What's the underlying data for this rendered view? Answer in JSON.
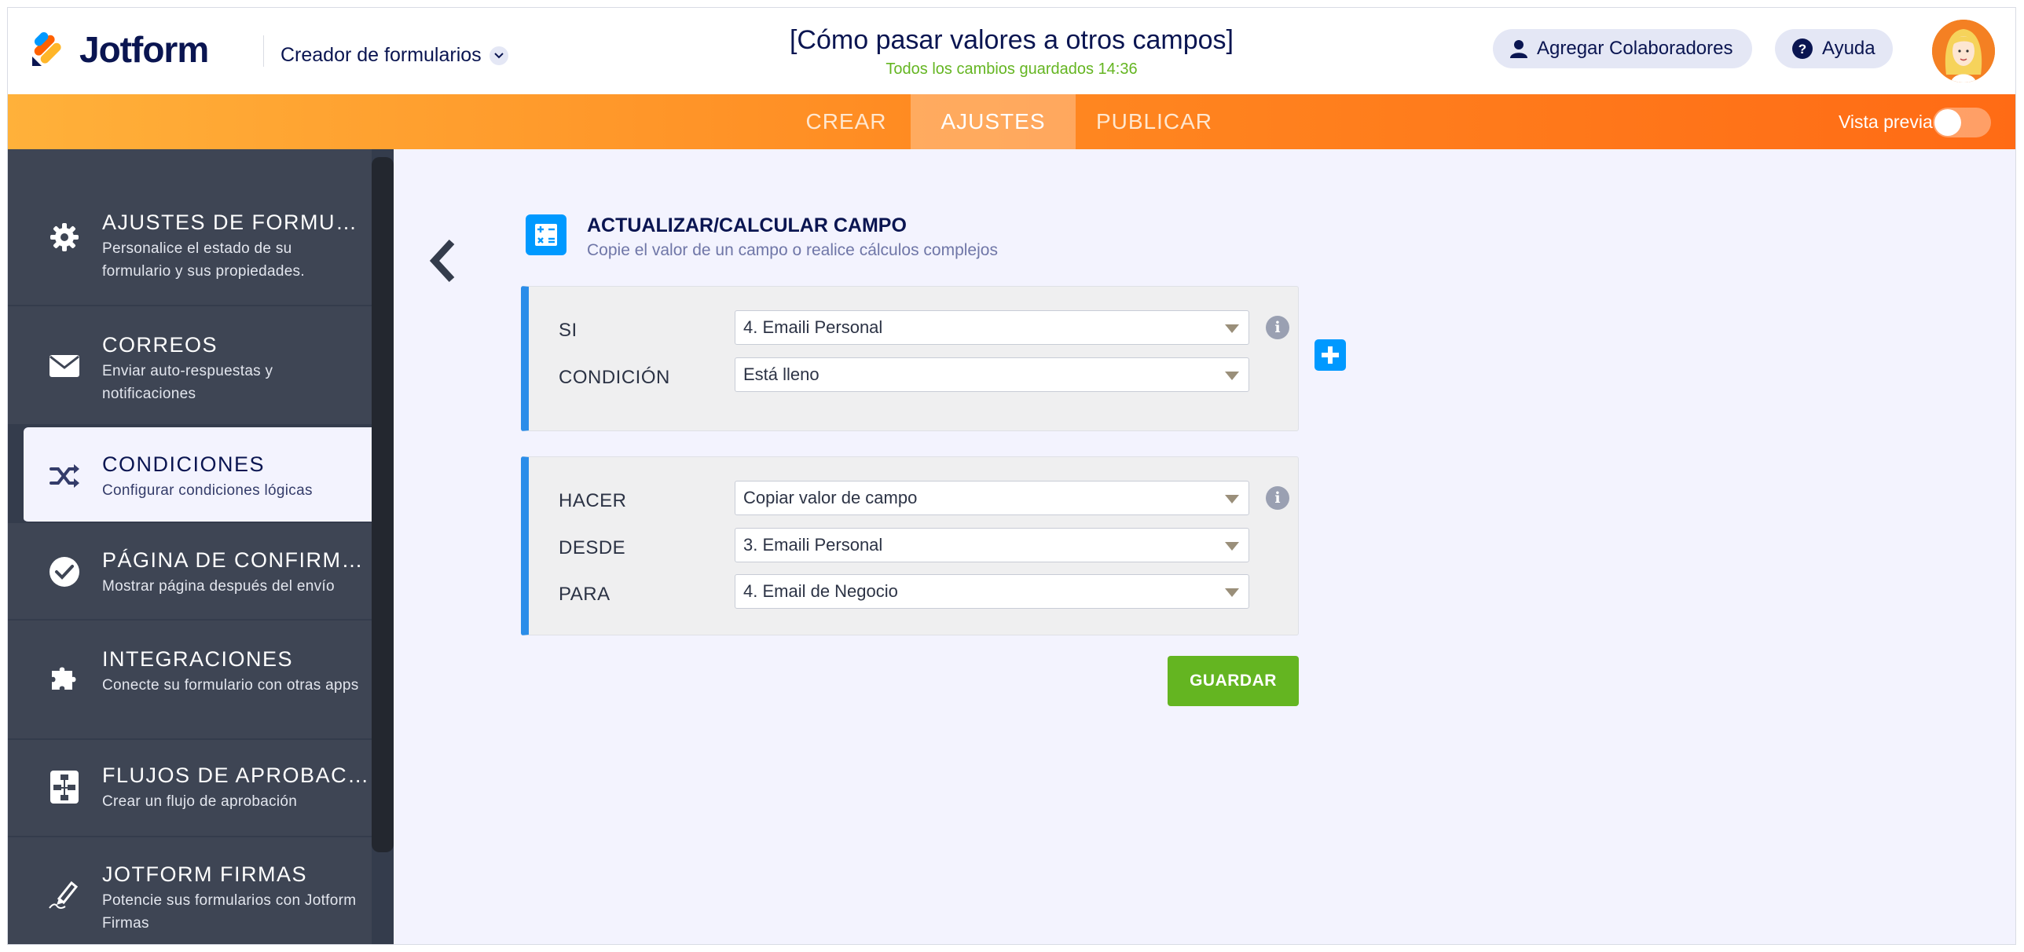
{
  "app": {
    "logo_text": "Jotform",
    "creator_label": "Creador de formularios"
  },
  "form": {
    "title": "[Cómo pasar valores a otros campos]",
    "saved_status": "Todos los cambios guardados 14:36"
  },
  "header": {
    "collaborators_label": "Agregar Colaboradores",
    "help_label": "Ayuda"
  },
  "tabs": {
    "crear": "CREAR",
    "ajustes": "AJUSTES",
    "publicar": "PUBLICAR",
    "preview_label": "Vista previa"
  },
  "sidebar": {
    "items": [
      {
        "title": "AJUSTES DE FORMULARIO",
        "desc": "Personalice el estado de su formulario y sus propiedades.",
        "icon": "gear-icon"
      },
      {
        "title": "CORREOS",
        "desc": "Enviar auto-respuestas y notificaciones",
        "icon": "envelope-icon"
      },
      {
        "title": "CONDICIONES",
        "desc": "Configurar condiciones lógicas",
        "icon": "shuffle-icon"
      },
      {
        "title": "PÁGINA DE CONFIRMACIÓN",
        "desc": "Mostrar página después del envío",
        "icon": "check-circle-icon"
      },
      {
        "title": "INTEGRACIONES",
        "desc": "Conecte su formulario con otras apps",
        "icon": "puzzle-icon"
      },
      {
        "title": "FLUJOS DE APROBACIÓN",
        "desc": "Crear un flujo de aprobación",
        "icon": "flowchart-icon"
      },
      {
        "title": "JOTFORM FIRMAS",
        "desc": "Potencie sus formularios con Jotform Firmas",
        "icon": "signature-pen-icon"
      }
    ]
  },
  "panel": {
    "title": "ACTUALIZAR/CALCULAR CAMPO",
    "subtitle": "Copie el valor de un campo o realice cálculos complejos",
    "if_block": {
      "si_label": "SI",
      "si_value": "4. Emaili Personal",
      "condicion_label": "CONDICIÓN",
      "condicion_value": "Está lleno"
    },
    "do_block": {
      "hacer_label": "HACER",
      "hacer_value": "Copiar valor de campo",
      "desde_label": "DESDE",
      "desde_value": "3. Emaili Personal",
      "para_label": "PARA",
      "para_value": "4. Email de Negocio"
    },
    "info_glyph": "i",
    "save_label": "GUARDAR"
  },
  "colors": {
    "accent_blue": "#0099ff",
    "save_green": "#64b521",
    "nav_orange": "#ff8b22",
    "sidebar_bg": "#343c4c"
  }
}
